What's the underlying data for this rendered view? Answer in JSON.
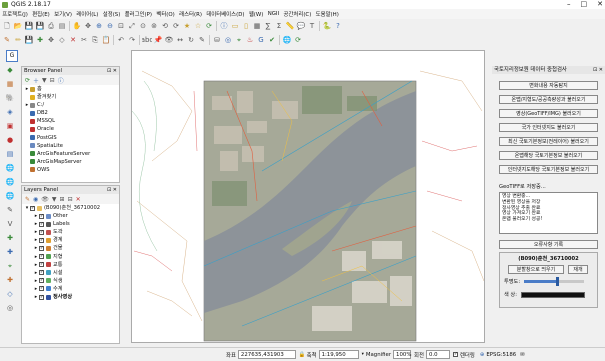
{
  "window": {
    "title": "QGIS 2.18.17"
  },
  "menubar": [
    "프로젝트(J)",
    "편집(E)",
    "보기(V)",
    "레이어(L)",
    "설정(S)",
    "플러그인(P)",
    "벡터(O)",
    "래스터(R)",
    "데이터베이스(D)",
    "웹(W)",
    "NGII",
    "공간처리(C)",
    "도움말(H)"
  ],
  "browser_panel": {
    "title": "Browser Panel",
    "items": [
      {
        "label": "홈",
        "icon": "home-icon",
        "exp": "▸"
      },
      {
        "label": "즐겨찾기",
        "icon": "star-icon",
        "exp": ""
      },
      {
        "label": "C:/",
        "icon": "drive-icon",
        "exp": "▸"
      },
      {
        "label": "DB2",
        "icon": "db2-icon",
        "exp": ""
      },
      {
        "label": "MSSQL",
        "icon": "mssql-icon",
        "exp": ""
      },
      {
        "label": "Oracle",
        "icon": "oracle-icon",
        "exp": ""
      },
      {
        "label": "PostGIS",
        "icon": "postgis-icon",
        "exp": ""
      },
      {
        "label": "SpatiaLite",
        "icon": "spatialite-icon",
        "exp": ""
      },
      {
        "label": "ArcGisFeatureServer",
        "icon": "arcgis-feature-icon",
        "exp": ""
      },
      {
        "label": "ArcGisMapServer",
        "icon": "arcgis-map-icon",
        "exp": ""
      },
      {
        "label": "OWS",
        "icon": "ows-icon",
        "exp": ""
      }
    ]
  },
  "layers_panel": {
    "title": "Layers Panel",
    "group": "(B090)춘천_36710002",
    "layers": [
      {
        "label": "Other",
        "color": "#6a8cc7",
        "checked": true
      },
      {
        "label": "Labels",
        "color": "#555555",
        "checked": true
      },
      {
        "label": "도곽",
        "color": "#c05050",
        "checked": true
      },
      {
        "label": "경계",
        "color": "#e0a030",
        "checked": true
      },
      {
        "label": "건물",
        "color": "#d08030",
        "checked": true
      },
      {
        "label": "지형",
        "color": "#50a050",
        "checked": true
      },
      {
        "label": "교통",
        "color": "#c04040",
        "checked": true
      },
      {
        "label": "시설",
        "color": "#40a0c0",
        "checked": true
      },
      {
        "label": "식생",
        "color": "#60b060",
        "checked": true
      },
      {
        "label": "수계",
        "color": "#4080d0",
        "checked": true
      },
      {
        "label": "정사영상",
        "color": "#3050a0",
        "checked": true,
        "bold": true
      }
    ]
  },
  "right_panel": {
    "title": "국토지리정보원 데이터 중첩검사",
    "buttons": [
      "변화내용 자동탐지",
      "온맵/지형도/공공측량성과 불러오기",
      "영상(GeoTIFF/IMG) 불러오기",
      "국가 인터넷지도 불러오기",
      "최신 국토기본정보(전레이어) 불러오기",
      "온맵해당 국토기본정보 불러오기",
      "인터넷지도해당 국토기본정보 불러오기"
    ],
    "save_label": "GeoTIFF로 저장중...",
    "log": [
      "영상 변환중...",
      "변환된 영상을 저장",
      "정사영상 추출 완료",
      "영상 가져오기 완료",
      "온맵 불러오기 성공!"
    ],
    "error_button": "오류사항 기록",
    "layer_name": "(B090)춘천_36710002",
    "clip_button": "분할창으로 띄우기",
    "reset_button": "재개",
    "opacity_label": "투명도:",
    "color_label": "색 상:",
    "opacity": 0.55
  },
  "status": {
    "coord_label": "좌표",
    "coord": "227635,431903",
    "scale_label": "축척",
    "scale": "1:19,950",
    "magnifier_label": "Magnifier",
    "magnifier": "100%",
    "rotation_label": "회전",
    "rotation": "0.0",
    "render_label": "렌더링",
    "epsg": "EPSG:5186"
  },
  "colors": {
    "river": "#8a9098",
    "imagery": "#a8ab9c",
    "accent": "#4a7cc7"
  }
}
